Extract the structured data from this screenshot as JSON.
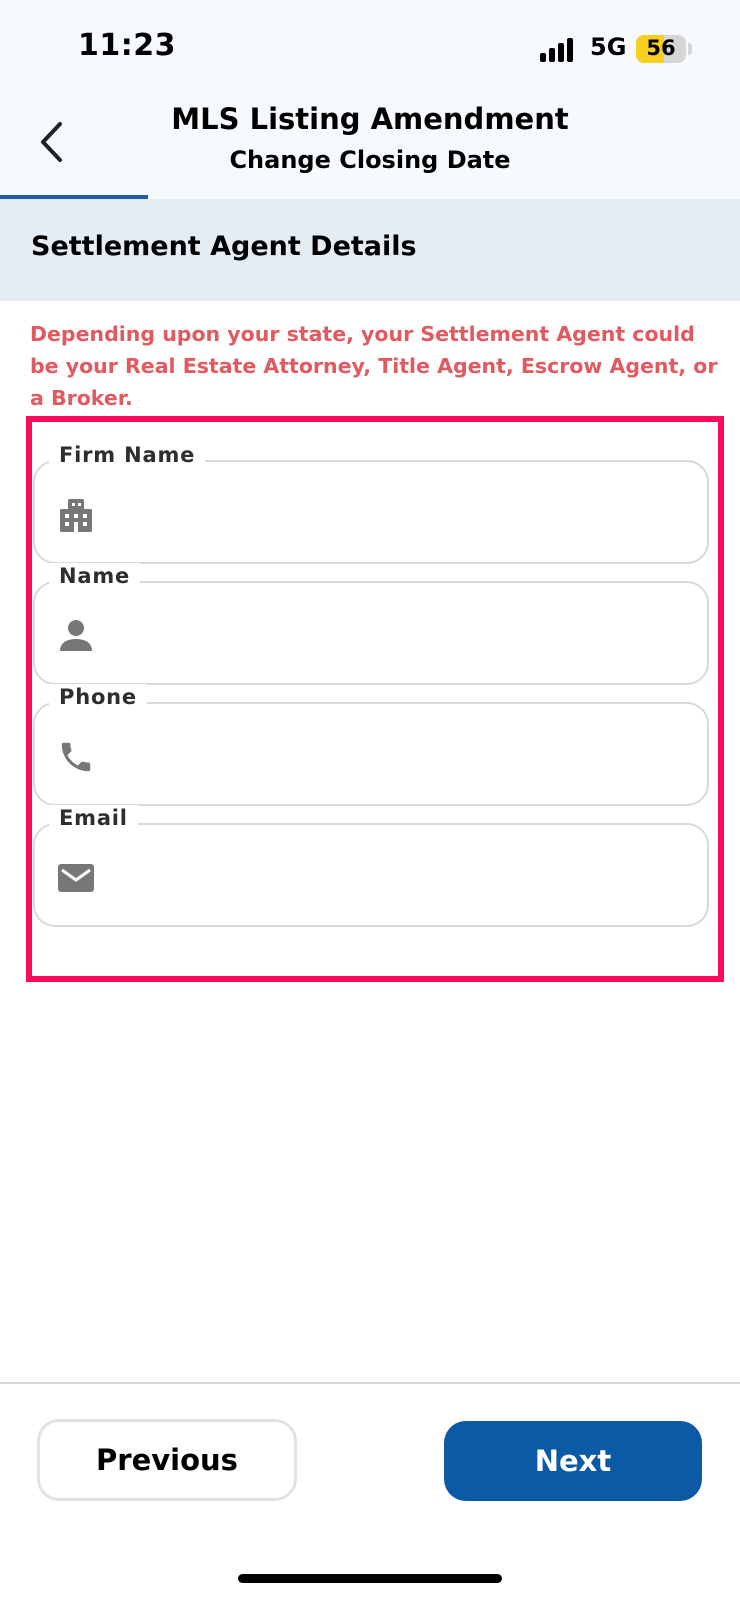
{
  "status_bar": {
    "time": "11:23",
    "network": "5G",
    "battery_level": "56"
  },
  "header": {
    "title": "MLS Listing Amendment",
    "subtitle": "Change Closing Date",
    "progress_fraction": 0.2
  },
  "section": {
    "title": "Settlement Agent Details",
    "notice": "Depending upon your state, your Settlement Agent could be your Real Estate Attorney, Title Agent, Escrow Agent, or a Broker."
  },
  "fields": [
    {
      "label": "Firm Name",
      "icon": "building-icon",
      "value": ""
    },
    {
      "label": "Name",
      "icon": "person-icon",
      "value": ""
    },
    {
      "label": "Phone",
      "icon": "phone-icon",
      "value": ""
    },
    {
      "label": "Email",
      "icon": "mail-icon",
      "value": ""
    }
  ],
  "footer": {
    "previous_label": "Previous",
    "next_label": "Next"
  },
  "colors": {
    "accent": "#0c5aa6",
    "notice": "#e05a5f",
    "highlight": "#fb0b5a",
    "section_bg": "#e4ecf4"
  }
}
